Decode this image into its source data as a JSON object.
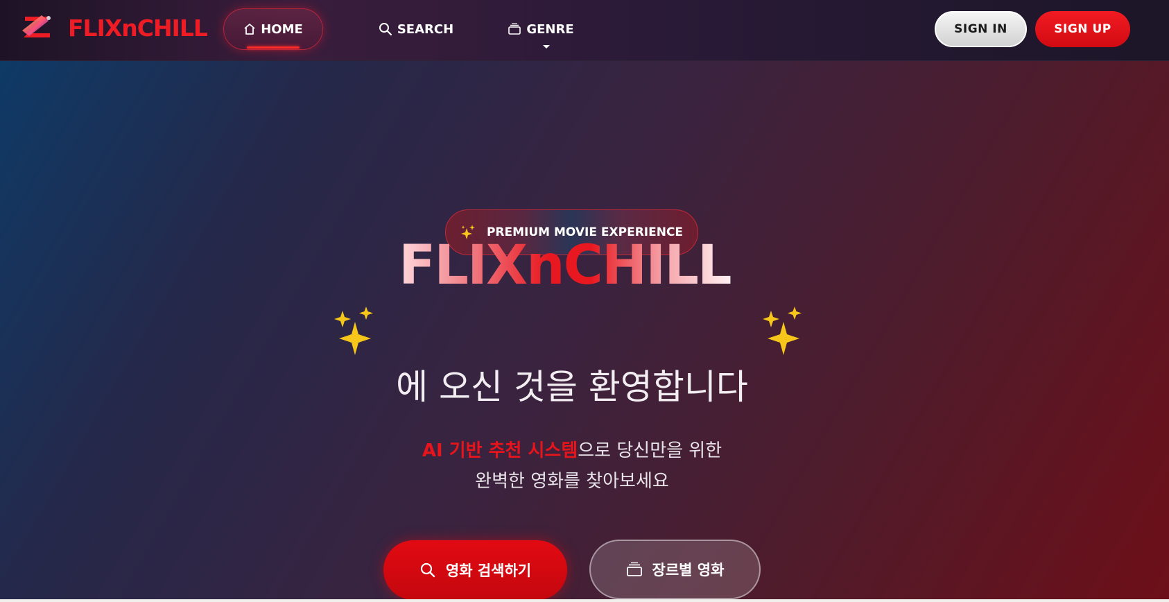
{
  "brand": {
    "name": "FLIXnCHILL",
    "logo_icon": "flixnchill-logo-icon"
  },
  "nav": {
    "items": [
      {
        "label": "HOME",
        "icon": "home-icon",
        "active": true
      },
      {
        "label": "SEARCH",
        "icon": "search-icon"
      },
      {
        "label": "GENRE",
        "icon": "folder-stack-icon",
        "has_dropdown": true
      }
    ],
    "sign_in": "SIGN IN",
    "sign_up": "SIGN UP"
  },
  "hero": {
    "badge": "PREMIUM MOVIE EXPERIENCE",
    "badge_icon": "sparkles-icon",
    "title": "FLIXnCHILL",
    "subtitle": "에 오신 것을 환영합니다",
    "desc_highlight": "AI 기반 추천 시스템",
    "desc_rest_1": "으로 당신만을 위한",
    "desc_line_2": "완벽한 영화를 찾아보세요",
    "cta_primary": "영화 검색하기",
    "cta_primary_icon": "search-icon",
    "cta_secondary": "장르별 영화",
    "cta_secondary_icon": "folder-stack-icon"
  },
  "colors": {
    "brand_red": "#ee1c24",
    "sparkle_yellow": "#f7c61a",
    "text_light": "#f2eef2"
  }
}
